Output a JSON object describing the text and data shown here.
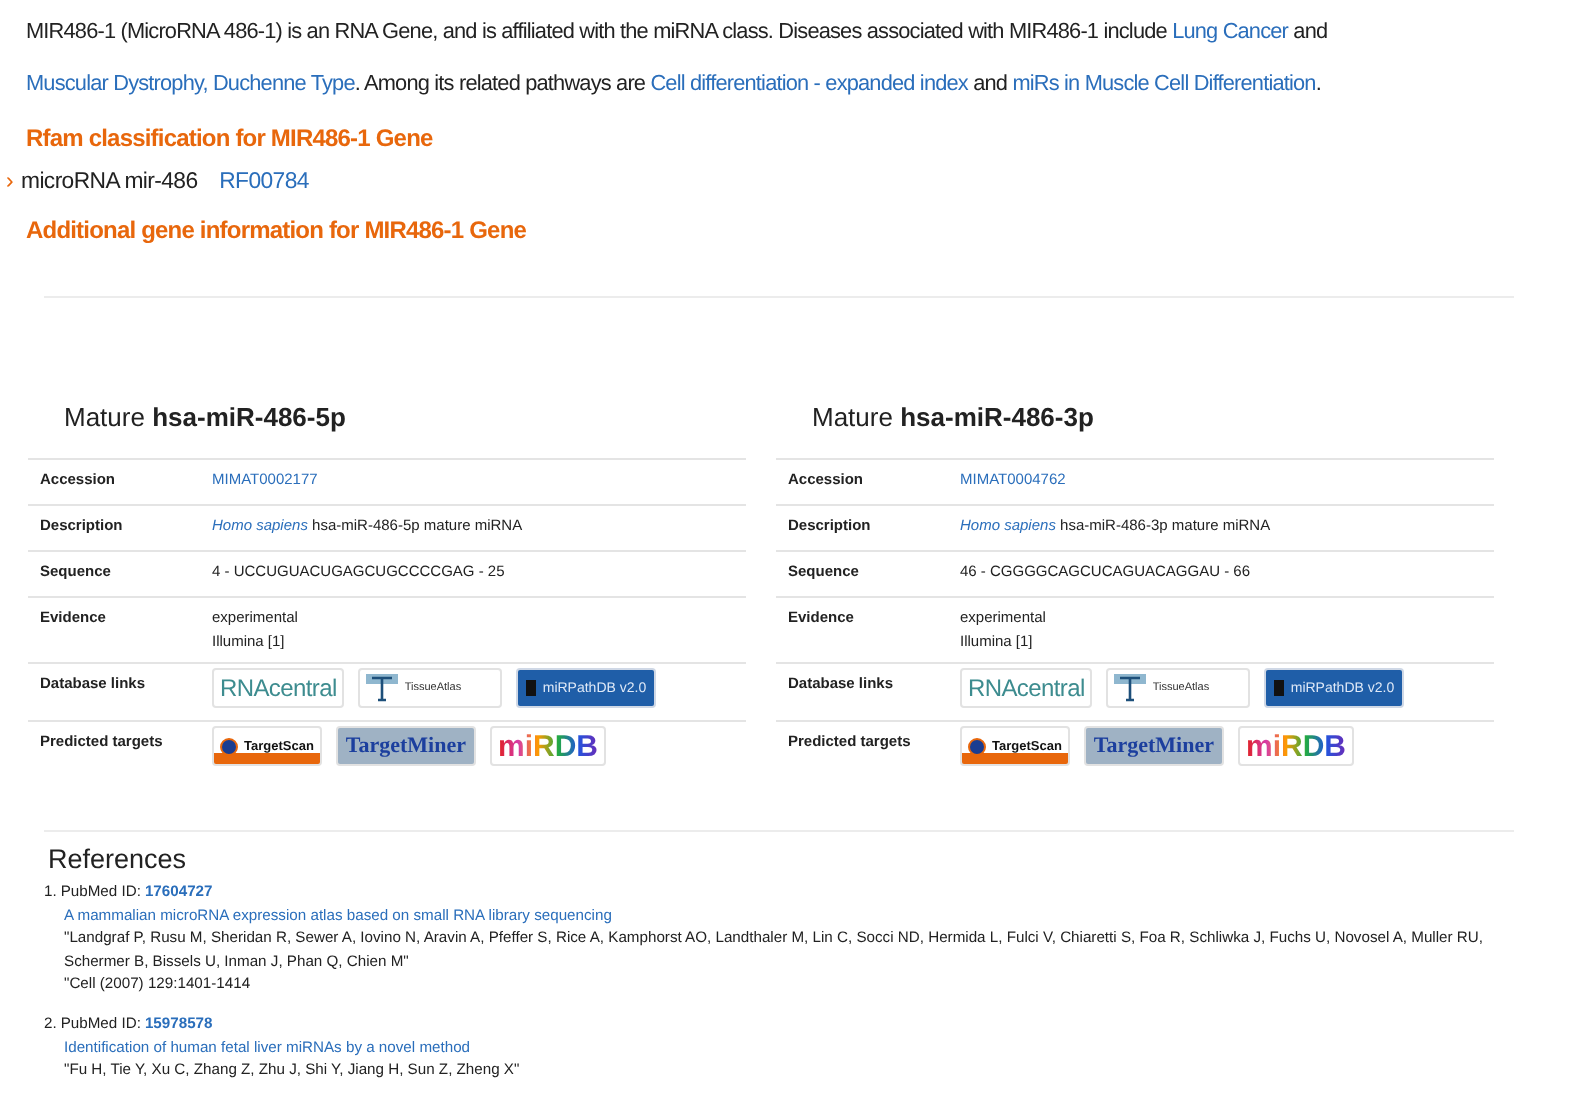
{
  "intro": [
    {
      "kind": "plain",
      "text": "MIR486-1 (MicroRNA 486-1) is an RNA Gene, and is affiliated with the miRNA class. Diseases associated with MIR486-1 include "
    },
    {
      "kind": "link",
      "text": "Lung Cancer"
    },
    {
      "kind": "plain",
      "text": " and "
    },
    {
      "kind": "link",
      "text": "Muscular Dystrophy, Duchenne Type"
    },
    {
      "kind": "plain",
      "text": ". Among its related pathways are "
    },
    {
      "kind": "link",
      "text": "Cell differentiation - expanded index"
    },
    {
      "kind": "plain",
      "text": " and "
    },
    {
      "kind": "link",
      "text": "miRs in Muscle Cell Differentiation"
    },
    {
      "kind": "plain",
      "text": "."
    }
  ],
  "rfam": {
    "heading": "Rfam classification for MIR486-1 Gene",
    "bullet": "›",
    "name": "microRNA mir-486",
    "accession": "RF00784"
  },
  "additional": {
    "heading": "Additional gene information for MIR486-1 Gene"
  },
  "matures": [
    {
      "prefix": "Mature",
      "name": "hsa-miR-486-5p",
      "rows": [
        {
          "kind": "link",
          "label": "Accession",
          "value": "MIMAT0002177"
        },
        {
          "kind": "description",
          "label": "Description",
          "species": "Homo sapiens",
          "value": "hsa-miR-486-5p mature miRNA"
        },
        {
          "kind": "text",
          "label": "Sequence",
          "value": "4 - UCCUGUACUGAGCUGCCCCGAG - 25"
        },
        {
          "kind": "lines",
          "label": "Evidence",
          "lines": [
            "experimental",
            "Illumina [1]"
          ]
        },
        {
          "kind": "logos",
          "label": "Database links",
          "logos": [
            {
              "kind": "rnacentral",
              "label": "RNAcentral"
            },
            {
              "kind": "tissueatlas",
              "label": "TissueAtlas"
            },
            {
              "kind": "mirpathdb",
              "label": "miRPathDB v2.0"
            }
          ]
        },
        {
          "kind": "logos",
          "label": "Predicted targets",
          "logos": [
            {
              "kind": "targetscan",
              "label": "TargetScan"
            },
            {
              "kind": "targetminer",
              "label": "TargetMiner"
            },
            {
              "kind": "mirdb",
              "label": "miRDB"
            }
          ]
        }
      ]
    },
    {
      "prefix": "Mature",
      "name": "hsa-miR-486-3p",
      "rows": [
        {
          "kind": "link",
          "label": "Accession",
          "value": "MIMAT0004762"
        },
        {
          "kind": "description",
          "label": "Description",
          "species": "Homo sapiens",
          "value": "hsa-miR-486-3p mature miRNA"
        },
        {
          "kind": "text",
          "label": "Sequence",
          "value": "46 - CGGGGCAGCUCAGUACAGGAU - 66"
        },
        {
          "kind": "lines",
          "label": "Evidence",
          "lines": [
            "experimental",
            "Illumina [1]"
          ]
        },
        {
          "kind": "logos",
          "label": "Database links",
          "logos": [
            {
              "kind": "rnacentral",
              "label": "RNAcentral"
            },
            {
              "kind": "tissueatlas",
              "label": "TissueAtlas"
            },
            {
              "kind": "mirpathdb",
              "label": "miRPathDB v2.0"
            }
          ]
        },
        {
          "kind": "logos",
          "label": "Predicted targets",
          "logos": [
            {
              "kind": "targetscan",
              "label": "TargetScan"
            },
            {
              "kind": "targetminer",
              "label": "TargetMiner"
            },
            {
              "kind": "mirdb",
              "label": "miRDB"
            }
          ]
        }
      ]
    }
  ],
  "references": {
    "heading": "References",
    "items": [
      {
        "number": "1.",
        "prefix": "PubMed ID:",
        "pmid": "17604727",
        "title": "A mammalian microRNA expression atlas based on small RNA library sequencing",
        "authors": "\"Landgraf P, Rusu M, Sheridan R, Sewer A, Iovino N, Aravin A, Pfeffer S, Rice A, Kamphorst AO, Landthaler M, Lin C, Socci ND, Hermida L, Fulci V, Chiaretti S, Foa R, Schliwka J, Fuchs U, Novosel A, Muller RU, Schermer B, Bissels U, Inman J, Phan Q, Chien M\"",
        "citation": "\"Cell (2007) 129:1401-1414"
      },
      {
        "number": "2.",
        "prefix": "PubMed ID:",
        "pmid": "15978578",
        "title": "Identification of human fetal liver miRNAs by a novel method",
        "authors": "\"Fu H, Tie Y, Xu C, Zhang Z, Zhu J, Shi Y, Jiang H, Sun Z, Zheng X\""
      }
    ]
  }
}
